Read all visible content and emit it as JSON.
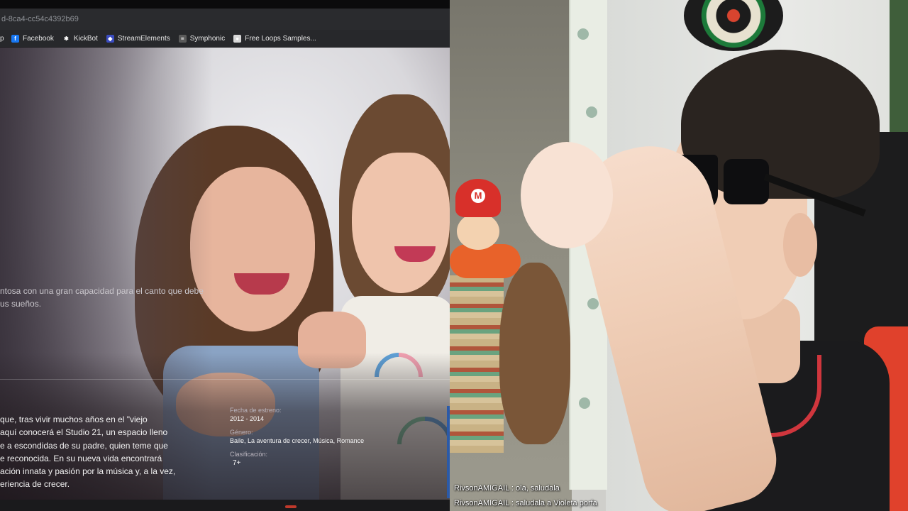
{
  "browser": {
    "url_fragment": "d-8ca4-cc54c4392b69",
    "bookmarks_lead": "p",
    "bookmarks": [
      {
        "label": "Facebook",
        "icon": "facebook-icon"
      },
      {
        "label": "KickBot",
        "icon": "kickbot-icon"
      },
      {
        "label": "StreamElements",
        "icon": "streamelements-icon"
      },
      {
        "label": "Symphonic",
        "icon": "page-icon"
      },
      {
        "label": "Free Loops Samples...",
        "icon": "freeloops-icon"
      }
    ]
  },
  "show": {
    "tagline_lines": [
      "ntosa con una gran capacidad para el canto que debe",
      "us sueños."
    ],
    "synopsis_lines": [
      "que, tras vivir muchos años en el \"viejo",
      "aquí conocerá el Studio 21, un espacio lleno",
      "e a escondidas de su padre, quien teme que",
      "e reconocida. En su nueva vida encontrará",
      "ación innata y pasión por la música y, a la vez,",
      "eriencia de crecer."
    ],
    "release_label": "Fecha de estreno:",
    "release_value": "2012 - 2014",
    "genre_label": "Género:",
    "genre_value": "Baile, La aventura de crecer, Música, Romance",
    "rating_label": "Clasificación:",
    "rating_value": "7+"
  },
  "webcam": {
    "chat": [
      {
        "user": "RivsonAMIGAIL",
        "sep": " : ",
        "message": "ola, saludala"
      },
      {
        "user": "RivsonAMIGAIL",
        "sep": " : ",
        "message": "saludala a Violeta porfa"
      }
    ]
  }
}
